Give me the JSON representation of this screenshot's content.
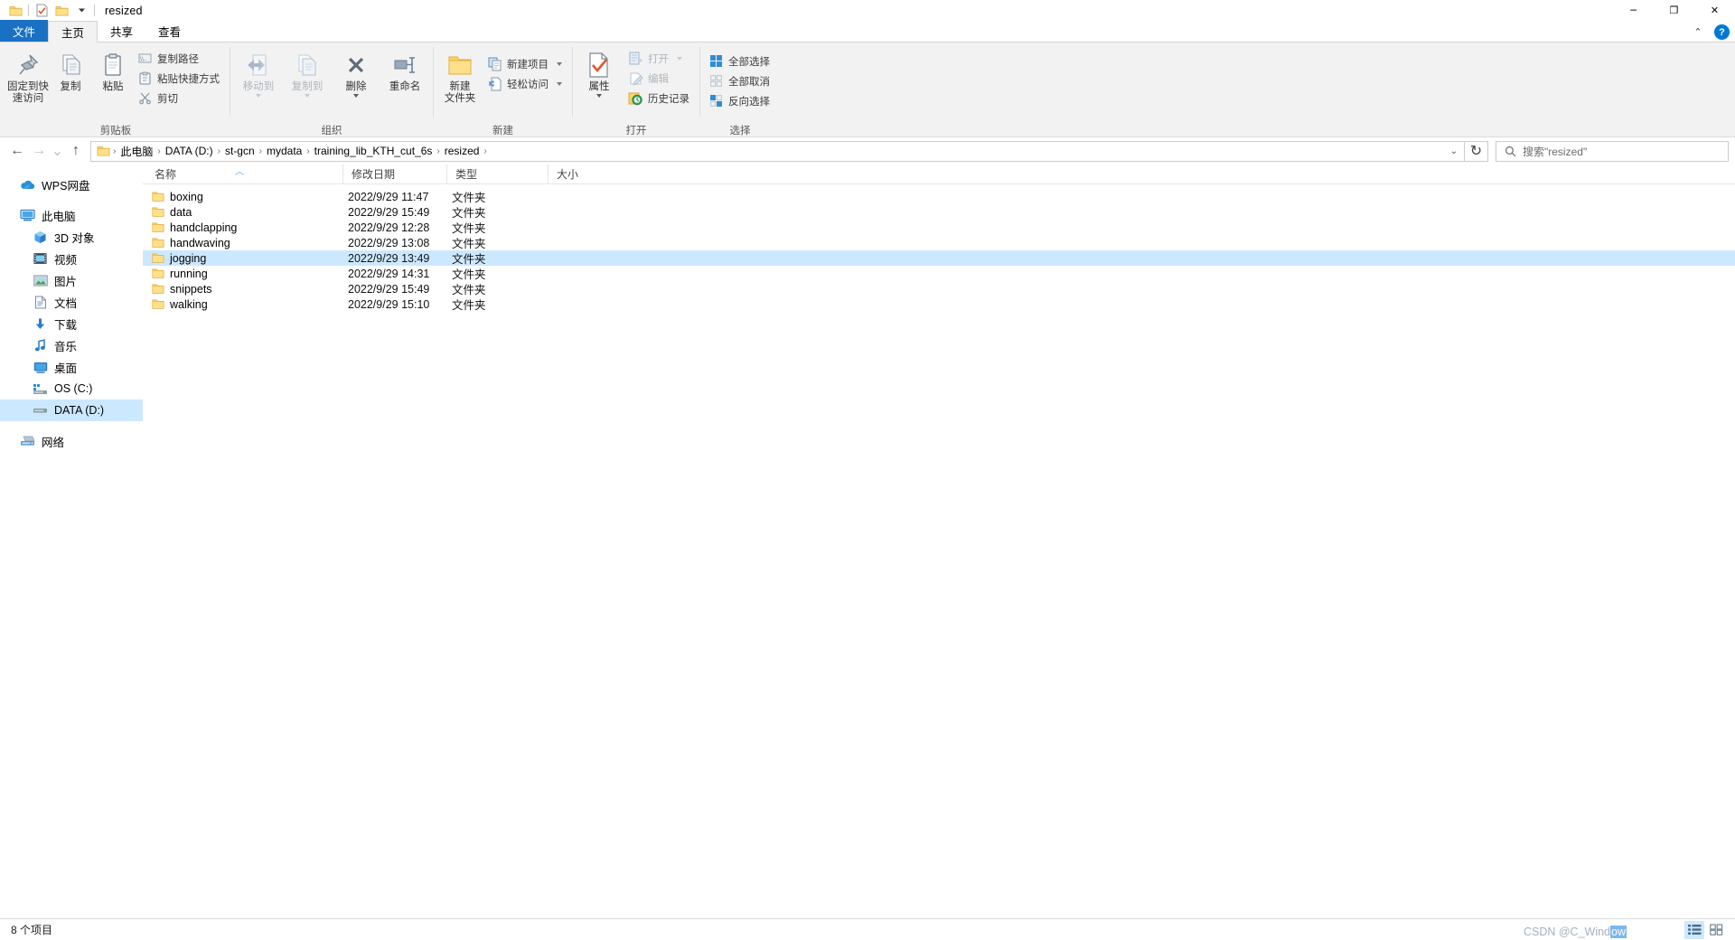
{
  "window": {
    "title": "resized",
    "quick_access": [
      "folder-icon",
      "properties-icon",
      "new-folder-icon",
      "customize-caret-icon"
    ],
    "caption": {
      "minimize": "─",
      "maximize": "❐",
      "close": "✕"
    }
  },
  "tabs": [
    {
      "id": "file",
      "label": "文件",
      "state": "file"
    },
    {
      "id": "home",
      "label": "主页",
      "state": "active"
    },
    {
      "id": "share",
      "label": "共享",
      "state": "normal"
    },
    {
      "id": "view",
      "label": "查看",
      "state": "normal"
    }
  ],
  "tab_right": {
    "collapse": "⌃",
    "help": "?"
  },
  "ribbon": {
    "groups": [
      {
        "id": "clipboard",
        "label": "剪贴板",
        "big": [
          {
            "id": "pin",
            "icon": "pin-icon",
            "label": "固定到快\n速访问"
          },
          {
            "id": "copy",
            "icon": "copy-icon",
            "label": "复制"
          },
          {
            "id": "paste",
            "icon": "paste-icon",
            "label": "粘贴"
          }
        ],
        "small": [
          {
            "id": "copy-path",
            "icon": "copy-path-icon",
            "label": "复制路径"
          },
          {
            "id": "paste-shortcut",
            "icon": "paste-shortcut-icon",
            "label": "粘贴快捷方式"
          },
          {
            "id": "cut",
            "icon": "scissors-icon",
            "label": "剪切"
          }
        ]
      },
      {
        "id": "organize",
        "label": "组织",
        "big": [
          {
            "id": "move-to",
            "icon": "move-to-icon",
            "label": "移动到",
            "dim": true,
            "caret": true
          },
          {
            "id": "copy-to",
            "icon": "copy-to-icon",
            "label": "复制到",
            "dim": true,
            "caret": true
          },
          {
            "id": "delete",
            "icon": "delete-icon",
            "label": "删除",
            "caret": true
          },
          {
            "id": "rename",
            "icon": "rename-icon",
            "label": "重命名"
          }
        ],
        "small": []
      },
      {
        "id": "new",
        "label": "新建",
        "big": [
          {
            "id": "new-folder",
            "icon": "new-folder-icon",
            "label": "新建\n文件夹"
          }
        ],
        "small": [
          {
            "id": "new-item",
            "icon": "new-item-icon",
            "label": "新建项目",
            "caret": true
          },
          {
            "id": "easy-access",
            "icon": "easy-access-icon",
            "label": "轻松访问",
            "caret": true
          }
        ]
      },
      {
        "id": "open",
        "label": "打开",
        "big": [
          {
            "id": "properties",
            "icon": "properties-icon",
            "label": "属性",
            "caret": true
          }
        ],
        "small": [
          {
            "id": "open",
            "icon": "open-icon",
            "label": "打开",
            "dim": true,
            "caret": true
          },
          {
            "id": "edit",
            "icon": "edit-icon",
            "label": "编辑",
            "dim": true
          },
          {
            "id": "history",
            "icon": "history-icon",
            "label": "历史记录"
          }
        ]
      },
      {
        "id": "select",
        "label": "选择",
        "big": [],
        "small": [
          {
            "id": "select-all",
            "icon": "select-all-icon",
            "label": "全部选择"
          },
          {
            "id": "select-none",
            "icon": "select-none-icon",
            "label": "全部取消"
          },
          {
            "id": "invert-select",
            "icon": "invert-select-icon",
            "label": "反向选择"
          }
        ]
      }
    ]
  },
  "address": {
    "back": "←",
    "forward": "→",
    "recent": "⌄",
    "up": "↑",
    "crumbs": [
      "此电脑",
      "DATA (D:)",
      "st-gcn",
      "mydata",
      "training_lib_KTH_cut_6s",
      "resized"
    ],
    "separator": "›",
    "dropdown": "⌄",
    "refresh": "↻"
  },
  "search": {
    "icon": "search-icon",
    "placeholder": "搜索\"resized\""
  },
  "navpane": {
    "items": [
      {
        "id": "wps",
        "label": "WPS网盘",
        "icon": "cloud-icon",
        "level": 1,
        "selected": false
      },
      {
        "id": "gap1",
        "type": "gap"
      },
      {
        "id": "thispc",
        "label": "此电脑",
        "icon": "monitor-icon",
        "level": 1,
        "selected": false
      },
      {
        "id": "3dobj",
        "label": "3D 对象",
        "icon": "cube-icon",
        "level": 2,
        "selected": false
      },
      {
        "id": "videos",
        "label": "视频",
        "icon": "video-icon",
        "level": 2,
        "selected": false
      },
      {
        "id": "pictures",
        "label": "图片",
        "icon": "picture-icon",
        "level": 2,
        "selected": false
      },
      {
        "id": "docs",
        "label": "文档",
        "icon": "doc-icon",
        "level": 2,
        "selected": false
      },
      {
        "id": "downloads",
        "label": "下载",
        "icon": "download-icon",
        "level": 2,
        "selected": false
      },
      {
        "id": "music",
        "label": "音乐",
        "icon": "music-icon",
        "level": 2,
        "selected": false
      },
      {
        "id": "desktop",
        "label": "桌面",
        "icon": "desktop-icon",
        "level": 2,
        "selected": false
      },
      {
        "id": "osc",
        "label": "OS (C:)",
        "icon": "drive-icon",
        "level": 2,
        "selected": false
      },
      {
        "id": "datad",
        "label": "DATA (D:)",
        "icon": "drive-icon",
        "level": 2,
        "selected": true
      },
      {
        "id": "gap2",
        "type": "gap"
      },
      {
        "id": "network",
        "label": "网络",
        "icon": "network-icon",
        "level": 1,
        "selected": false
      }
    ]
  },
  "filelist": {
    "columns": [
      {
        "id": "name",
        "label": "名称",
        "sorted": true,
        "sort_dir": "asc"
      },
      {
        "id": "date",
        "label": "修改日期",
        "sorted": false
      },
      {
        "id": "type",
        "label": "类型",
        "sorted": false
      },
      {
        "id": "size",
        "label": "大小",
        "sorted": false
      }
    ],
    "rows": [
      {
        "name": "boxing",
        "date": "2022/9/29 11:47",
        "type": "文件夹",
        "size": "",
        "selected": false
      },
      {
        "name": "data",
        "date": "2022/9/29 15:49",
        "type": "文件夹",
        "size": "",
        "selected": false
      },
      {
        "name": "handclapping",
        "date": "2022/9/29 12:28",
        "type": "文件夹",
        "size": "",
        "selected": false
      },
      {
        "name": "handwaving",
        "date": "2022/9/29 13:08",
        "type": "文件夹",
        "size": "",
        "selected": false
      },
      {
        "name": "jogging",
        "date": "2022/9/29 13:49",
        "type": "文件夹",
        "size": "",
        "selected": true
      },
      {
        "name": "running",
        "date": "2022/9/29 14:31",
        "type": "文件夹",
        "size": "",
        "selected": false
      },
      {
        "name": "snippets",
        "date": "2022/9/29 15:49",
        "type": "文件夹",
        "size": "",
        "selected": false
      },
      {
        "name": "walking",
        "date": "2022/9/29 15:10",
        "type": "文件夹",
        "size": "",
        "selected": false
      }
    ]
  },
  "status": {
    "count_text": "8 个项目",
    "view_details": "details-view-icon",
    "view_large": "large-icons-view-icon"
  },
  "watermark": {
    "text": "CSDN @C_Wind",
    "highlight": "ow"
  },
  "colors": {
    "accent": "#0078d7",
    "file_tab": "#1a71c4",
    "selection": "#cce8ff",
    "folder_yellow": "#fcd462",
    "ribbon_bg": "#f2f2f2"
  }
}
